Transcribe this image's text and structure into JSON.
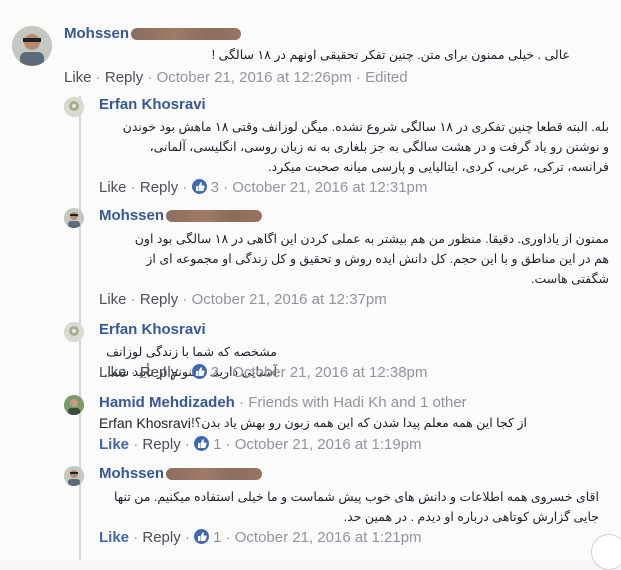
{
  "comments": [
    {
      "author_first": "Mohssen",
      "text": "عالی . خیلی ممنون برای متن. چنین تفکر تحقیقی اونهم در ۱۸ سالگی !",
      "actions": {
        "like": "Like",
        "reply": "Reply",
        "time": "October 21, 2016 at 12:26pm",
        "edited": "Edited"
      }
    },
    {
      "author": "Erfan Khosravi",
      "text_lines": [
        "بله. البته قطعا چنین تفکری در ۱۸ سالگی شروع نشده. میگن لوزانف وقتی ۱۸ ماهش بود خوندن",
        "و نوشتن رو یاد گرفت و در هشت سالگی به جز بلغاری به نه زبان روسی، انگلیسی، آلمانی،",
        "فرانسه، ترکی، عربی، کردی، ایتالیایی و پارسی میانه صحبت میکرد."
      ],
      "actions": {
        "like": "Like",
        "reply": "Reply",
        "count": "3",
        "time": "October 21, 2016 at 12:31pm"
      }
    },
    {
      "author_first": "Mohssen",
      "text_lines": [
        "ممنون از یاداوری. دقیقا. منظور من هم بیشتر به عملی کردن این اگاهی در ۱۸ سالگی بود اون",
        "هم در این مناطق و با این حجم. کل دانش ایده روش و تحقیق و کل زندگی او مجموعه ای از",
        "شگفتی هاست."
      ],
      "actions": {
        "like": "Like",
        "reply": "Reply",
        "time": "October 21, 2016 at 12:37pm"
      }
    },
    {
      "author": "Erfan Khosravi",
      "text": "مشخصه که شما با زندگی لوزانف آشنایی دارید. ممنونم از تأیید شما.",
      "actions": {
        "like": "Like",
        "reply": "Reply",
        "count": "2",
        "time": "October 21, 2016 at 12:38pm"
      }
    },
    {
      "author": "Hamid Mehdizadeh",
      "friends": "Friends with Hadi Kh and 1 other",
      "mention": "Erfan Khosravi",
      "text": "از کجا این همه معلم پیدا شدن که این همه زبون رو بهش یاد بدن؟!",
      "actions": {
        "like": "Like",
        "reply": "Reply",
        "count": "1",
        "time": "October 21, 2016 at 1:19pm"
      }
    },
    {
      "author_first": "Mohssen",
      "text_lines": [
        "اقای خسروی همه اطلاعات و دانش های خوب پیش شماست و ما خیلی استفاده میکنیم. من تنها",
        "جایی گزارش کوتاهی درباره او دیدم . در همین حد."
      ],
      "actions": {
        "like": "Like",
        "reply": "Reply",
        "count": "1",
        "time": "October 21, 2016 at 1:21pm"
      }
    }
  ],
  "separator": "·",
  "colors": {
    "link": "#365899",
    "meta": "#90949c",
    "like_blue": "#4267b2",
    "line": "#d3d6db"
  },
  "icons": [
    "avatar-photo",
    "like-thumb-icon"
  ]
}
